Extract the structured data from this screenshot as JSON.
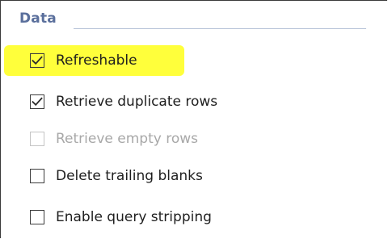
{
  "group": {
    "title": "Data"
  },
  "checkboxes": [
    {
      "label": "Refreshable",
      "checked": true,
      "enabled": true,
      "highlighted": true
    },
    {
      "label": "Retrieve duplicate rows",
      "checked": true,
      "enabled": true
    },
    {
      "label": "Retrieve empty rows",
      "checked": false,
      "enabled": false
    },
    {
      "label": "Delete trailing blanks",
      "checked": false,
      "enabled": true
    },
    {
      "label": "Enable query stripping",
      "checked": false,
      "enabled": true
    }
  ],
  "colors": {
    "highlight": "#ffff3b",
    "group_title": "#5a6f9c",
    "disabled_text": "#a8a8a8"
  },
  "icons": {
    "check": "checkmark-icon"
  }
}
